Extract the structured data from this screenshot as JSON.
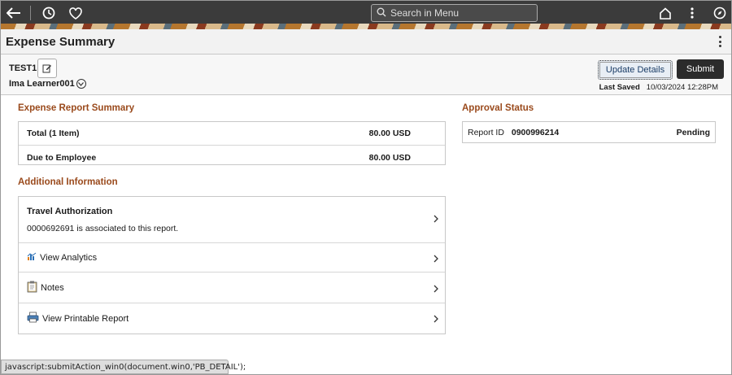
{
  "topbar": {
    "search_placeholder": "Search in Menu",
    "icons": [
      "back-arrow-icon",
      "history-icon",
      "favorites-heart-icon",
      "home-icon",
      "actions-kebab-icon",
      "navigator-compass-icon"
    ]
  },
  "page": {
    "title": "Expense Summary"
  },
  "header": {
    "report_name": "TEST1",
    "employee": "Ima Learner001",
    "update_label": "Update Details",
    "submit_label": "Submit",
    "last_saved_label": "Last Saved",
    "last_saved_value": "10/03/2024 12:28PM"
  },
  "summary": {
    "heading": "Expense Report Summary",
    "rows": [
      {
        "label": "Total (1 Item)",
        "value": "80.00 USD"
      },
      {
        "label": "Due to Employee",
        "value": "80.00 USD"
      }
    ]
  },
  "additional": {
    "heading": "Additional Information",
    "travel_title": "Travel Authorization",
    "travel_text": "0000692691 is associated to this report.",
    "links": [
      {
        "label": "View Analytics",
        "icon": "analytics-icon"
      },
      {
        "label": "Notes",
        "icon": "notes-clipboard-icon"
      },
      {
        "label": "View Printable Report",
        "icon": "printer-icon"
      }
    ]
  },
  "approval": {
    "heading": "Approval Status",
    "report_id_label": "Report ID",
    "report_id": "0900996214",
    "status": "Pending"
  },
  "statusbar": {
    "text": "javascript:submitAction_win0(document.win0,'PB_DETAIL');"
  },
  "colors": {
    "accent_heading": "#9a4a1c",
    "submit_bg": "#2b2b2b",
    "topbar_bg": "#3b3b3b"
  }
}
